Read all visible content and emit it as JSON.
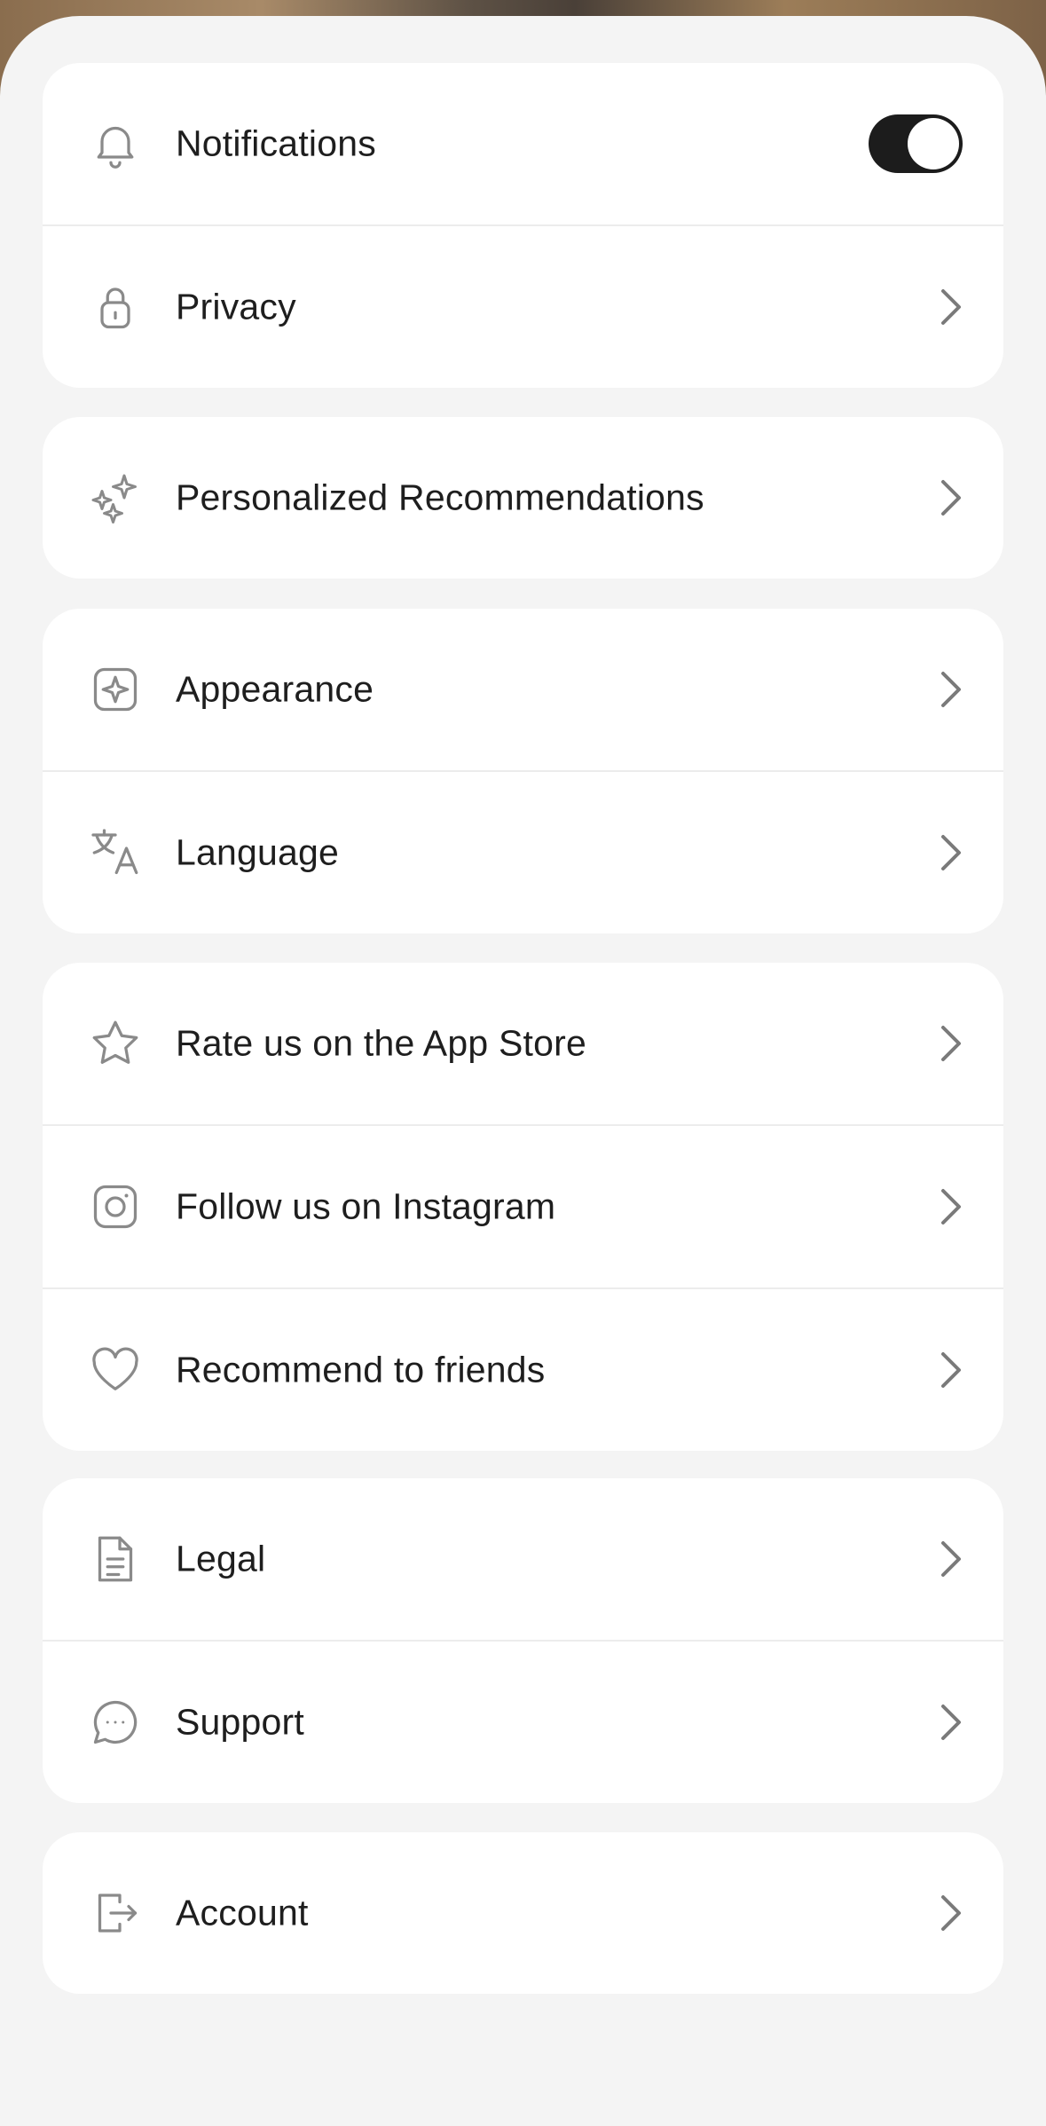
{
  "settings": {
    "groups": [
      {
        "items": [
          {
            "label": "Notifications",
            "icon": "bell-icon",
            "control": "toggle",
            "toggle_on": true
          },
          {
            "label": "Privacy",
            "icon": "lock-icon",
            "control": "chevron"
          }
        ]
      },
      {
        "items": [
          {
            "label": "Personalized Recommendations",
            "icon": "sparkles-icon",
            "control": "chevron"
          }
        ]
      },
      {
        "items": [
          {
            "label": "Appearance",
            "icon": "appearance-icon",
            "control": "chevron"
          },
          {
            "label": "Language",
            "icon": "translate-icon",
            "control": "chevron"
          }
        ]
      },
      {
        "items": [
          {
            "label": "Rate us on the App Store",
            "icon": "star-icon",
            "control": "chevron"
          },
          {
            "label": "Follow us on Instagram",
            "icon": "instagram-icon",
            "control": "chevron"
          },
          {
            "label": "Recommend to friends",
            "icon": "heart-icon",
            "control": "chevron"
          }
        ]
      },
      {
        "items": [
          {
            "label": "Legal",
            "icon": "document-icon",
            "control": "chevron"
          },
          {
            "label": "Support",
            "icon": "chat-icon",
            "control": "chevron"
          }
        ]
      },
      {
        "items": [
          {
            "label": "Account",
            "icon": "logout-icon",
            "control": "chevron"
          }
        ]
      }
    ]
  },
  "colors": {
    "background": "#f4f4f4",
    "card": "#ffffff",
    "text": "#1e1e1e",
    "icon": "#8a8a8a",
    "toggle_on": "#1c1c1c"
  }
}
